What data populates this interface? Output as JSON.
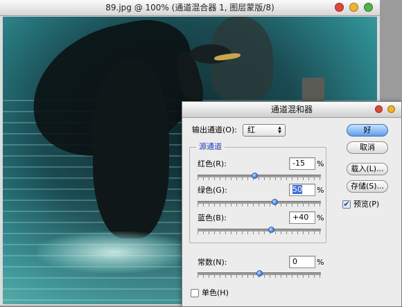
{
  "document": {
    "title": "89.jpg @ 100% (通道混合器 1, 图层蒙版/8)",
    "window_buttons": [
      "close",
      "minimize",
      "zoom"
    ]
  },
  "dialog": {
    "title": "通道混和器",
    "output_channel": {
      "label": "输出通道(O):",
      "value": "红"
    },
    "source_group_title": "源通道",
    "red": {
      "label": "红色(R):",
      "value": "-15",
      "unit": "%",
      "percent": -15
    },
    "green": {
      "label": "绿色(G):",
      "value": "50",
      "unit": "%",
      "percent": 50
    },
    "blue": {
      "label": "蓝色(B):",
      "value": "+40",
      "unit": "%",
      "percent": 40
    },
    "constant": {
      "label": "常数(N):",
      "value": "0",
      "unit": "%",
      "percent": 0
    },
    "monochrome": {
      "label": "单色(H)",
      "checked": false
    },
    "buttons": {
      "ok": "好",
      "cancel": "取消",
      "load": "载入(L)...",
      "save": "存储(S)..."
    },
    "preview": {
      "label": "预览(P)",
      "checked": true,
      "check_glyph": "✔"
    },
    "select_arrow_up": "▲",
    "select_arrow_down": "▼"
  },
  "colors": {
    "traffic_close": "#e0463a",
    "traffic_minimize": "#f2b32a",
    "traffic_zoom": "#4db34a"
  }
}
